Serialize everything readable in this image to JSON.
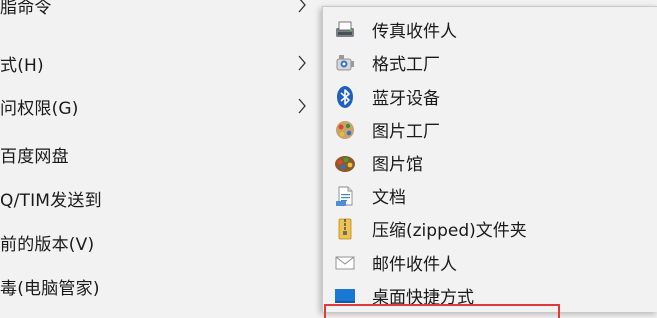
{
  "main_menu": {
    "items": [
      {
        "label": "脂命令",
        "has_submenu": true
      },
      {
        "label": "式(H)",
        "has_submenu": true
      },
      {
        "label": "问权限(G)",
        "has_submenu": true
      },
      {
        "label": "百度网盘",
        "has_submenu": false
      },
      {
        "label": "Q/TIM发送到",
        "has_submenu": false
      },
      {
        "label": "前的版本(V)",
        "has_submenu": false
      },
      {
        "label": "毒(电脑管家)",
        "has_submenu": false
      }
    ]
  },
  "send_to_menu": {
    "items": [
      {
        "label": "传真收件人",
        "icon": "fax-icon"
      },
      {
        "label": "格式工厂",
        "icon": "format-factory-icon"
      },
      {
        "label": "蓝牙设备",
        "icon": "bluetooth-icon"
      },
      {
        "label": "图片工厂",
        "icon": "picture-factory-icon"
      },
      {
        "label": "图片馆",
        "icon": "picture-gallery-icon"
      },
      {
        "label": "文档",
        "icon": "documents-icon"
      },
      {
        "label": "压缩(zipped)文件夹",
        "icon": "zip-folder-icon"
      },
      {
        "label": "邮件收件人",
        "icon": "mail-icon"
      },
      {
        "label": "桌面快捷方式",
        "icon": "desktop-icon"
      }
    ]
  },
  "colors": {
    "menu_background": "#f2f2f2",
    "highlight_border": "#e03b3b",
    "bluetooth_blue": "#1f5fbf"
  }
}
